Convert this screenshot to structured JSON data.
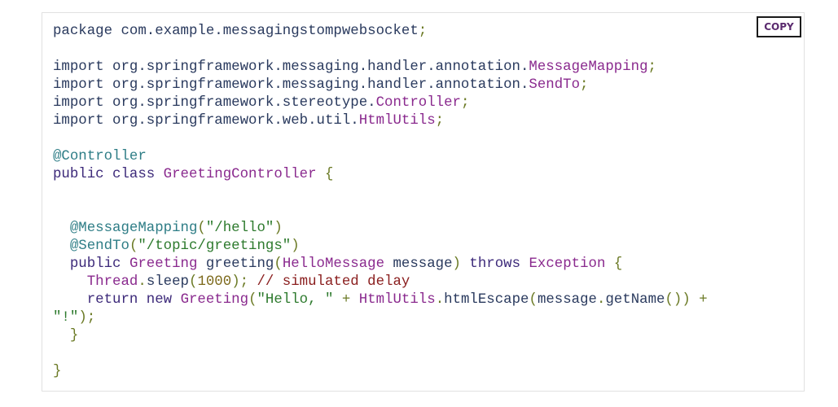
{
  "copy_button": {
    "label": "COPY"
  },
  "colors": {
    "plain": "#2a3a5e",
    "type": "#8a2a8e",
    "punctuation": "#6b7a25",
    "annotation": "#2e7d86",
    "keyword": "#3d2a7a",
    "string": "#2d7a2d",
    "literal": "#7d6a1c",
    "comment": "#8a1e1e",
    "button_text": "#5a2a6e"
  },
  "code": {
    "language": "java",
    "lines": [
      [
        [
          "pln",
          "package com.example.messagingstompwebsocket"
        ],
        [
          "pun",
          ";"
        ]
      ],
      [],
      [
        [
          "pln",
          "import org.springframework.messaging.handler.annotation."
        ],
        [
          "typ",
          "MessageMapping"
        ],
        [
          "pun",
          ";"
        ]
      ],
      [
        [
          "pln",
          "import org.springframework.messaging.handler.annotation."
        ],
        [
          "typ",
          "SendTo"
        ],
        [
          "pun",
          ";"
        ]
      ],
      [
        [
          "pln",
          "import org.springframework.stereotype."
        ],
        [
          "typ",
          "Controller"
        ],
        [
          "pun",
          ";"
        ]
      ],
      [
        [
          "pln",
          "import org.springframework.web.util."
        ],
        [
          "typ",
          "HtmlUtils"
        ],
        [
          "pun",
          ";"
        ]
      ],
      [],
      [
        [
          "ann",
          "@Controller"
        ]
      ],
      [
        [
          "kwd",
          "public class "
        ],
        [
          "typ",
          "GreetingController"
        ],
        [
          "pln",
          " "
        ],
        [
          "pun",
          "{"
        ]
      ],
      [],
      [],
      [
        [
          "pln",
          "  "
        ],
        [
          "ann",
          "@MessageMapping"
        ],
        [
          "pun",
          "("
        ],
        [
          "str",
          "\"/hello\""
        ],
        [
          "pun",
          ")"
        ]
      ],
      [
        [
          "pln",
          "  "
        ],
        [
          "ann",
          "@SendTo"
        ],
        [
          "pun",
          "("
        ],
        [
          "str",
          "\"/topic/greetings\""
        ],
        [
          "pun",
          ")"
        ]
      ],
      [
        [
          "pln",
          "  "
        ],
        [
          "kwd",
          "public "
        ],
        [
          "typ",
          "Greeting"
        ],
        [
          "pln",
          " greeting"
        ],
        [
          "pun",
          "("
        ],
        [
          "typ",
          "HelloMessage"
        ],
        [
          "pln",
          " message"
        ],
        [
          "pun",
          ")"
        ],
        [
          "pln",
          " "
        ],
        [
          "kwd",
          "throws "
        ],
        [
          "typ",
          "Exception"
        ],
        [
          "pln",
          " "
        ],
        [
          "pun",
          "{"
        ]
      ],
      [
        [
          "pln",
          "    "
        ],
        [
          "typ",
          "Thread"
        ],
        [
          "pun",
          "."
        ],
        [
          "pln",
          "sleep"
        ],
        [
          "pun",
          "("
        ],
        [
          "lit",
          "1000"
        ],
        [
          "pun",
          ");"
        ],
        [
          "pln",
          " "
        ],
        [
          "com",
          "// simulated delay"
        ]
      ],
      [
        [
          "pln",
          "    "
        ],
        [
          "kwd",
          "return new "
        ],
        [
          "typ",
          "Greeting"
        ],
        [
          "pun",
          "("
        ],
        [
          "str",
          "\"Hello, \""
        ],
        [
          "pln",
          " "
        ],
        [
          "pun",
          "+"
        ],
        [
          "pln",
          " "
        ],
        [
          "typ",
          "HtmlUtils"
        ],
        [
          "pun",
          "."
        ],
        [
          "pln",
          "htmlEscape"
        ],
        [
          "pun",
          "("
        ],
        [
          "pln",
          "message"
        ],
        [
          "pun",
          "."
        ],
        [
          "pln",
          "getName"
        ],
        [
          "pun",
          "())"
        ],
        [
          "pln",
          " "
        ],
        [
          "pun",
          "+"
        ]
      ],
      [
        [
          "str",
          "\"!\""
        ],
        [
          "pun",
          ");"
        ]
      ],
      [
        [
          "pln",
          "  "
        ],
        [
          "pun",
          "}"
        ]
      ],
      [],
      [
        [
          "pun",
          "}"
        ]
      ]
    ]
  }
}
